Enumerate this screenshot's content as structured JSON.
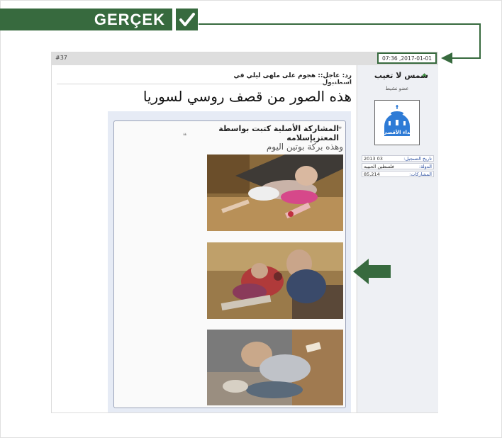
{
  "banner": {
    "label": "GERÇEK"
  },
  "post": {
    "number": "#37",
    "date": "2017-01-01, 07:36",
    "reply_title": "رد: عاجل:: هجوم على ملهى ليلي في اسطنبول",
    "title": "هذه الصور من قصف روسي لسوريا"
  },
  "user": {
    "name": "شمس لا تغيب",
    "status": "عضو نشيط",
    "avatar_label": "نداء الأقصى",
    "info": [
      {
        "key": "تاريخ التسجيل:",
        "value": "03 2013"
      },
      {
        "key": "الدولة:",
        "value": "فلسطين الحبيبه"
      },
      {
        "key": "المشاركات:",
        "value": "85,214"
      }
    ]
  },
  "quote": {
    "header": "المشاركة الأصلية كتبت بواسطة المعتزبإسلامه",
    "text": "وهذه بركة بوتين اليوم"
  },
  "colors": {
    "accent": "#376a3e"
  }
}
